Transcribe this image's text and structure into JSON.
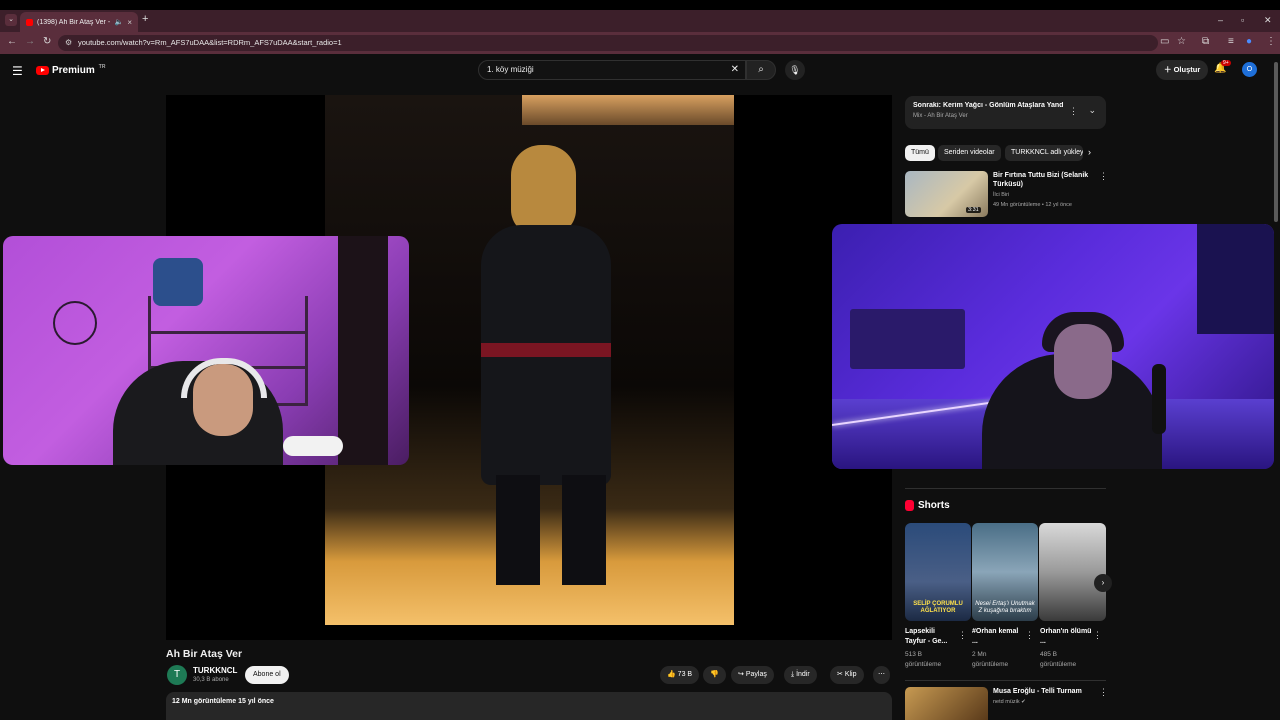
{
  "browser": {
    "tab_title": "(1398) Ah Bir Ataş Ver - YouTube",
    "url": "youtube.com/watch?v=Rm_AFS7uDAA&list=RDRm_AFS7uDAA&start_radio=1"
  },
  "masthead": {
    "logo_text": "Premium",
    "logo_region": "TR",
    "search_value": "1. köy müziği",
    "create_label": "Oluştur",
    "notif_count": "9+",
    "avatar_letter": "O"
  },
  "video": {
    "title": "Ah Bir Ataş Ver",
    "channel_initial": "T",
    "channel": "TURKKNCL",
    "subscribers": "30,3 B abone",
    "subscribe_label": "Abone ol",
    "likes": "73 B",
    "share": "Paylaş",
    "download": "İndir",
    "clip": "Klip",
    "meta": "12 Mn görüntüleme  15 yıl önce"
  },
  "mix": {
    "next": "Sonraki: Kerim Yağcı - Gönlüm Ataşlara Yand...",
    "subtitle": "Mix - Ah Bir Ataş Ver"
  },
  "chips": [
    "Tümü",
    "Seriden videolar",
    "TURKKNCL adlı yükleyici"
  ],
  "recommended": [
    {
      "title": "Bir Fırtına Tuttu Bizi (Selanik Türküsü)",
      "channel": "İlci Biri",
      "meta": "49 Mn görüntüleme • 12 yıl önce",
      "duration": "3:31"
    }
  ],
  "shorts": {
    "heading": "Shorts",
    "items": [
      {
        "title": "Lapsekili Tayfur - Ge...",
        "views": "513 B görüntüleme",
        "overlay": "SELİP ÇORUMLU AĞLATIYOR"
      },
      {
        "title": "#Orhan kemal ...",
        "views": "2 Mn görüntüleme",
        "overlay": "Nesei Ertaş'ı Unutmak Z kuşağına bıraktım"
      },
      {
        "title": "Orhan'ın ölümü ...",
        "views": "485 B görüntüleme",
        "overlay": ""
      }
    ]
  },
  "bottom_rec": {
    "title": "Musa Eroğlu - Telli Turnam",
    "channel": "netd müzik"
  }
}
